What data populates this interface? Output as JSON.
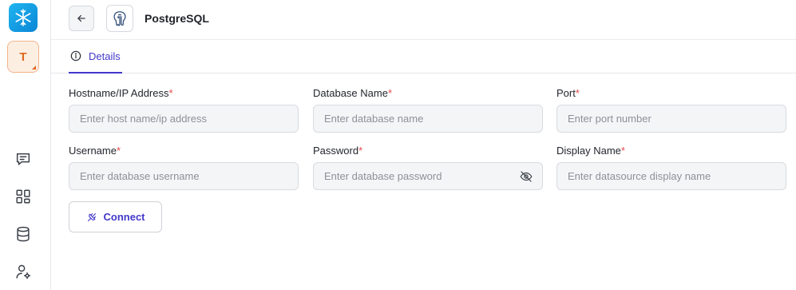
{
  "app": {
    "avatar_initial": "T"
  },
  "header": {
    "title": "PostgreSQL"
  },
  "tabs": [
    {
      "label": "Details",
      "active": true
    }
  ],
  "form": {
    "hostname": {
      "label": "Hostname/IP Address",
      "required_mark": "*",
      "placeholder": "Enter host name/ip address",
      "value": ""
    },
    "database": {
      "label": "Database Name",
      "required_mark": "*",
      "placeholder": "Enter database name",
      "value": ""
    },
    "port": {
      "label": "Port",
      "required_mark": "*",
      "placeholder": "Enter port number",
      "value": ""
    },
    "username": {
      "label": "Username",
      "required_mark": "*",
      "placeholder": "Enter database username",
      "value": ""
    },
    "password": {
      "label": "Password",
      "required_mark": "*",
      "placeholder": "Enter database password",
      "value": ""
    },
    "display_name": {
      "label": "Display Name",
      "required_mark": "*",
      "placeholder": "Enter datasource display name",
      "value": ""
    }
  },
  "actions": {
    "connect_label": "Connect"
  },
  "icons": {
    "logo": "snowflake-logo-icon",
    "back": "arrow-left-icon",
    "datasource": "postgresql-elephant-icon",
    "tab_details": "info-circle-icon",
    "chat": "chat-icon",
    "apps": "grid-icon",
    "database": "database-icon",
    "user_settings": "user-settings-icon",
    "password_toggle": "eye-off-icon",
    "connect": "plug-icon"
  },
  "colors": {
    "accent": "#4338ca",
    "required": "#e5484d",
    "avatar_text": "#e0671e",
    "logo": "#1fb5f0"
  }
}
